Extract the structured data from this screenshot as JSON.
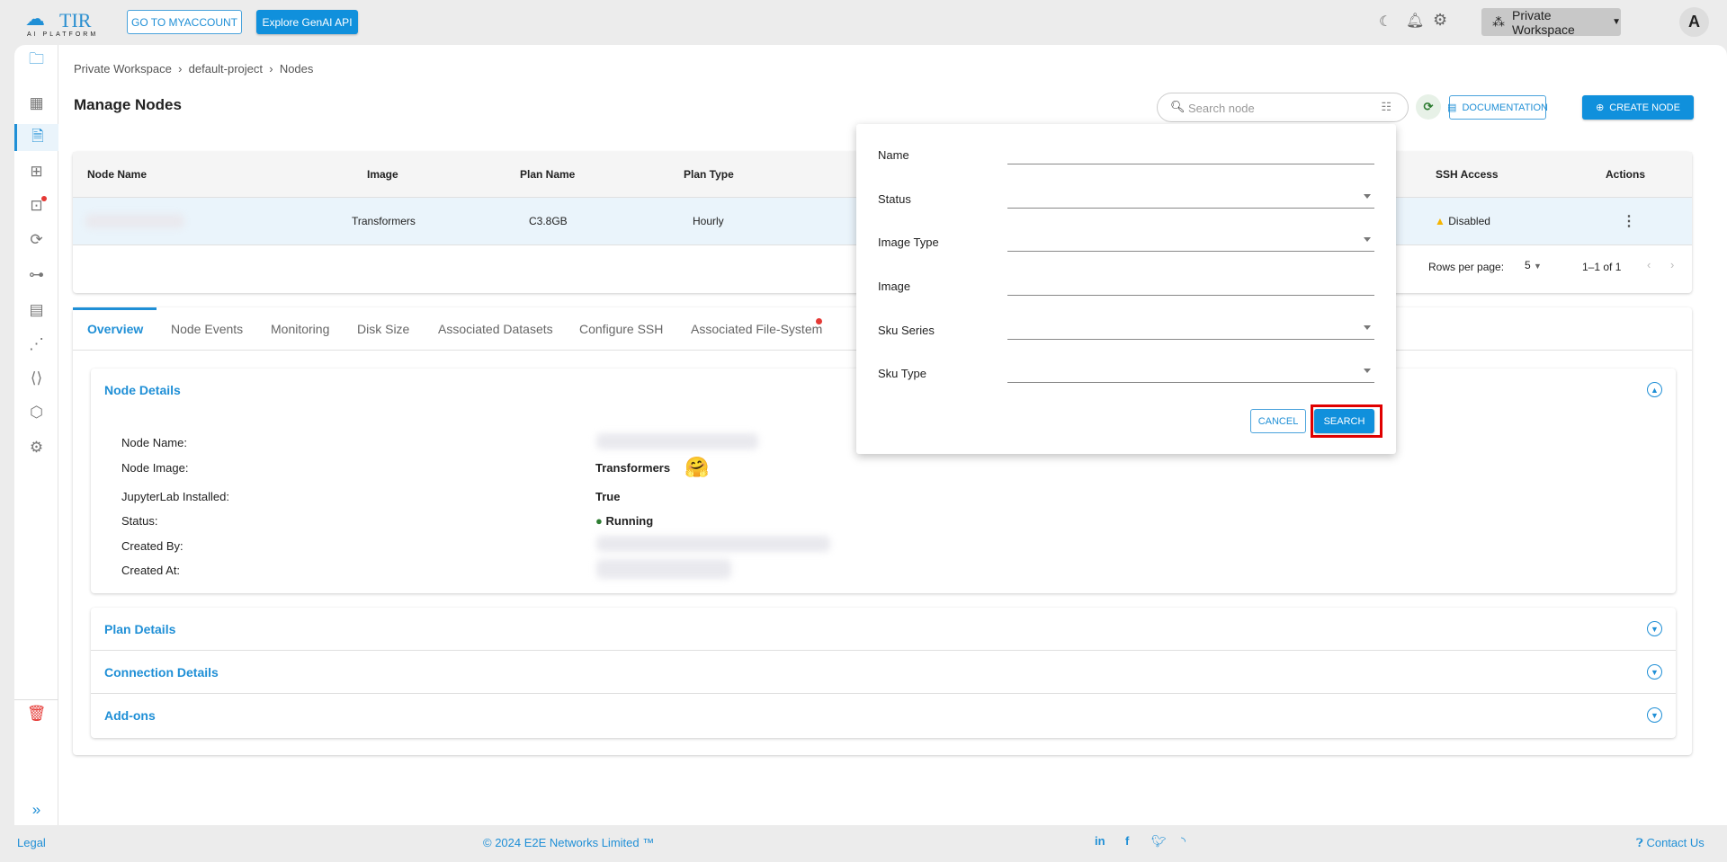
{
  "header": {
    "logo_text": "TIR",
    "logo_sub": "AI PLATFORM",
    "myaccount": "GO TO MYACCOUNT",
    "genai": "Explore GenAI API",
    "workspace": "Private Workspace",
    "avatar": "A"
  },
  "breadcrumb": [
    "Private Workspace",
    "default-project",
    "Nodes"
  ],
  "page_title": "Manage Nodes",
  "toolbar": {
    "search_placeholder": "Search node",
    "documentation": "DOCUMENTATION",
    "create": "CREATE NODE"
  },
  "table": {
    "columns": [
      "Node Name",
      "Image",
      "Plan Name",
      "Plan Type",
      "SSH Access",
      "Actions"
    ],
    "rows": [
      {
        "image": "Transformers",
        "plan_name": "C3.8GB",
        "plan_type": "Hourly",
        "ssh": "Disabled"
      }
    ],
    "rows_per_page_label": "Rows per page:",
    "rows_per_page": "5",
    "range": "1–1 of 1"
  },
  "tabs": [
    "Overview",
    "Node Events",
    "Monitoring",
    "Disk Size",
    "Associated Datasets",
    "Configure SSH",
    "Associated File-System"
  ],
  "node_details": {
    "title": "Node Details",
    "labels": [
      "Node Name:",
      "Node Image:",
      "JupyterLab Installed:",
      "Status:",
      "Created By:",
      "Created At:"
    ],
    "image": "Transformers",
    "jupyter": "True",
    "status": "Running",
    "status_color": "#2e7d32"
  },
  "sections": [
    "Plan Details",
    "Connection Details",
    "Add-ons"
  ],
  "filter": {
    "fields": [
      "Name",
      "Status",
      "Image Type",
      "Image",
      "Sku Series",
      "Sku Type"
    ],
    "cancel": "CANCEL",
    "search": "SEARCH"
  },
  "footer": {
    "legal": "Legal",
    "copyright": "© 2024 E2E Networks Limited ™",
    "contact": "Contact Us"
  },
  "colors": {
    "accent": "#1090dc",
    "highlight": "#e00000"
  }
}
